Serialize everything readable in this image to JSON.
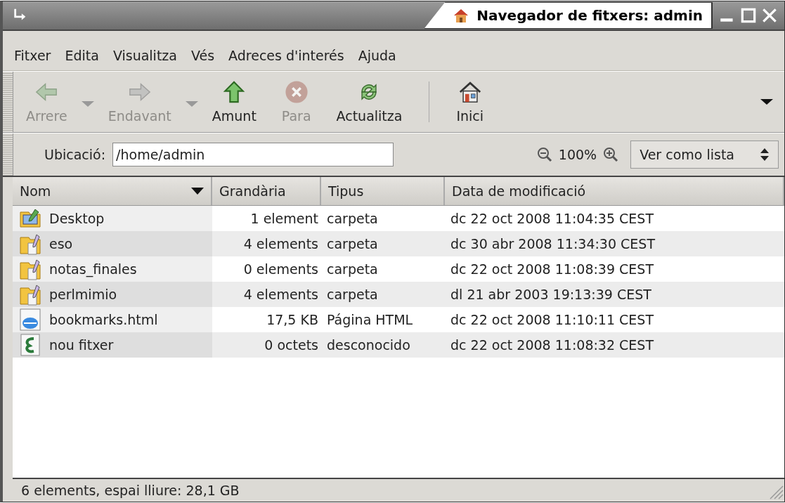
{
  "window": {
    "title": "Navegador de fitxers: admin"
  },
  "menu": [
    "Fitxer",
    "Edita",
    "Visualitza",
    "Vés",
    "Adreces d'interés",
    "Ajuda"
  ],
  "toolbar": [
    {
      "kind": "back",
      "label": "Arrere",
      "disabled": true,
      "dropdown": true
    },
    {
      "kind": "forward",
      "label": "Endavant",
      "disabled": true,
      "dropdown": true
    },
    {
      "kind": "up",
      "label": "Amunt",
      "disabled": false,
      "dropdown": false
    },
    {
      "kind": "stop",
      "label": "Para",
      "disabled": true,
      "dropdown": false
    },
    {
      "kind": "reload",
      "label": "Actualitza",
      "disabled": false,
      "dropdown": false
    },
    {
      "kind": "home",
      "label": "Inici",
      "disabled": false,
      "dropdown": false
    }
  ],
  "location": {
    "label": "Ubicació:",
    "value": "/home/admin",
    "zoom": "100%",
    "view": "Ver como lista"
  },
  "table": {
    "columns": [
      {
        "label": "Nom",
        "sorted": true
      },
      {
        "label": "Grandària",
        "sorted": false
      },
      {
        "label": "Tipus",
        "sorted": false
      },
      {
        "label": "Data de modificació",
        "sorted": false
      }
    ],
    "rows": [
      {
        "kind": "desktop",
        "name": "Desktop",
        "size": "1 element",
        "type": "carpeta",
        "date": "dc 22 oct 2008 11:04:35 CEST"
      },
      {
        "kind": "folder",
        "name": "eso",
        "size": "4 elements",
        "type": "carpeta",
        "date": "dc 30 abr 2008 11:34:30 CEST"
      },
      {
        "kind": "folder",
        "name": "notas_finales",
        "size": "0 elements",
        "type": "carpeta",
        "date": "dc 22 oct 2008 11:08:39 CEST"
      },
      {
        "kind": "folder",
        "name": "perlmimio",
        "size": "4 elements",
        "type": "carpeta",
        "date": "dl 21 abr 2003 19:13:39 CEST"
      },
      {
        "kind": "html",
        "name": "bookmarks.html",
        "size": "17,5 KB",
        "type": "Página HTML",
        "date": "dc 22 oct 2008 11:10:11 CEST"
      },
      {
        "kind": "unknown",
        "name": "nou fitxer",
        "size": "0 octets",
        "type": "desconocido",
        "date": "dc 22 oct 2008 11:08:32 CEST"
      }
    ]
  },
  "status_bar": "6 elements, espai lliure: 28,1 GB"
}
